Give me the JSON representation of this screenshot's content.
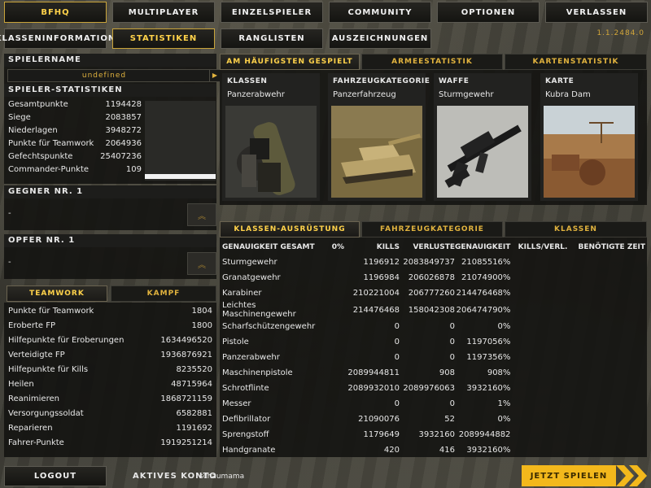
{
  "nav": {
    "bfhq": "BFHQ",
    "multiplayer": "MULTIPLAYER",
    "einzelspieler": "EINZELSPIELER",
    "community": "COMMUNITY",
    "optionen": "OPTIONEN",
    "verlassen": "VERLASSEN"
  },
  "subnav": {
    "klasseninfo": "KLASSENINFORMATION",
    "statistiken": "STATISTIKEN",
    "ranglisten": "RANGLISTEN",
    "auszeichnungen": "AUSZEICHNUNGEN"
  },
  "version": "1.1.2484.0",
  "player": {
    "name_label": "SPIELERNAME",
    "name_value": "undefined"
  },
  "stats": {
    "title": "SPIELER-STATISTIKEN",
    "rows": [
      {
        "label": "Gesamtpunkte",
        "value": "1194428"
      },
      {
        "label": "Siege",
        "value": "2083857"
      },
      {
        "label": "Niederlagen",
        "value": "3948272"
      },
      {
        "label": "Punkte für Teamwork",
        "value": "2064936"
      },
      {
        "label": "Gefechtspunkte",
        "value": "25407236"
      },
      {
        "label": "Commander-Punkte",
        "value": "109"
      }
    ]
  },
  "gegner": {
    "title": "GEGNER NR. 1",
    "value": "-"
  },
  "opfer": {
    "title": "OPFER NR. 1",
    "value": "-"
  },
  "teamwork": {
    "tab_teamwork": "TEAMWORK",
    "tab_kampf": "KAMPF",
    "rows": [
      {
        "label": "Punkte für Teamwork",
        "value": "1804"
      },
      {
        "label": "Eroberte FP",
        "value": "1800"
      },
      {
        "label": "Hilfepunkte für Eroberungen",
        "value": "1634496520"
      },
      {
        "label": "Verteidigte FP",
        "value": "1936876921"
      },
      {
        "label": "Hilfepunkte für Kills",
        "value": "8235520"
      },
      {
        "label": "Heilen",
        "value": "48715964"
      },
      {
        "label": "Reanimieren",
        "value": "1868721159"
      },
      {
        "label": "Versorgungssoldat",
        "value": "6582881"
      },
      {
        "label": "Reparieren",
        "value": "1191692"
      },
      {
        "label": "Fahrer-Punkte",
        "value": "1919251214"
      }
    ]
  },
  "top_tabs": {
    "most_played": "AM HÄUFIGSTEN GESPIELT",
    "armee": "ARMEESTATISTIK",
    "karten": "KARTENSTATISTIK"
  },
  "cards": [
    {
      "title": "KLASSEN",
      "value": "Panzerabwehr"
    },
    {
      "title": "FAHRZEUGKATEGORIE",
      "value": "Panzerfahrzeug"
    },
    {
      "title": "WAFFE",
      "value": "Sturmgewehr"
    },
    {
      "title": "KARTE",
      "value": "Kubra Dam"
    }
  ],
  "bottom_tabs": {
    "klassen_ausruestung": "KLASSEN-AUSRÜSTUNG",
    "fahrzeugkategorie": "FAHRZEUGKATEGORIE",
    "klassen": "KLASSEN"
  },
  "weapons": {
    "headers": [
      "GENAUIGKEIT GESAMT",
      "0%",
      "KILLS",
      "VERLUSTE",
      "GENAUIGKEIT",
      "KILLS/VERL.",
      "BENÖTIGTE ZEIT"
    ],
    "rows": [
      {
        "name": "Sturmgewehr",
        "kills": "1196912",
        "verluste": "2083849737",
        "genau": "21085516%"
      },
      {
        "name": "Granatgewehr",
        "kills": "1196984",
        "verluste": "206026878",
        "genau": "21074900%"
      },
      {
        "name": "Karabiner",
        "kills": "210221004",
        "verluste": "206777260",
        "genau": "214476468%"
      },
      {
        "name": "Leichtes Maschinengewehr",
        "kills": "214476468",
        "verluste": "158042308",
        "genau": "206474790%"
      },
      {
        "name": "Scharfschützengewehr",
        "kills": "0",
        "verluste": "0",
        "genau": "0%"
      },
      {
        "name": "Pistole",
        "kills": "0",
        "verluste": "0",
        "genau": "1197056%"
      },
      {
        "name": "Panzerabwehr",
        "kills": "0",
        "verluste": "0",
        "genau": "1197356%"
      },
      {
        "name": "Maschinenpistole",
        "kills": "2089944811",
        "verluste": "908",
        "genau": "908%"
      },
      {
        "name": "Schrotflinte",
        "kills": "2089932010",
        "verluste": "2089976063",
        "genau": "3932160%"
      },
      {
        "name": "Messer",
        "kills": "0",
        "verluste": "0",
        "genau": "1%"
      },
      {
        "name": "Defibrillator",
        "kills": "21090076",
        "verluste": "52",
        "genau": "0%"
      },
      {
        "name": "Sprengstoff",
        "kills": "1179649",
        "verluste": "3932160",
        "genau": "2089944882"
      },
      {
        "name": "Handgranate",
        "kills": "420",
        "verluste": "416",
        "genau": "3932160%"
      }
    ]
  },
  "footer": {
    "logout": "LOGOUT",
    "account_label": "AKTIVES KONTO",
    "account_name": "schaumama",
    "play": "JETZT SPIELEN"
  },
  "colors": {
    "accent": "#ffd24a",
    "gold_border": "#c9a43a",
    "play_button": "#f3b81c"
  }
}
